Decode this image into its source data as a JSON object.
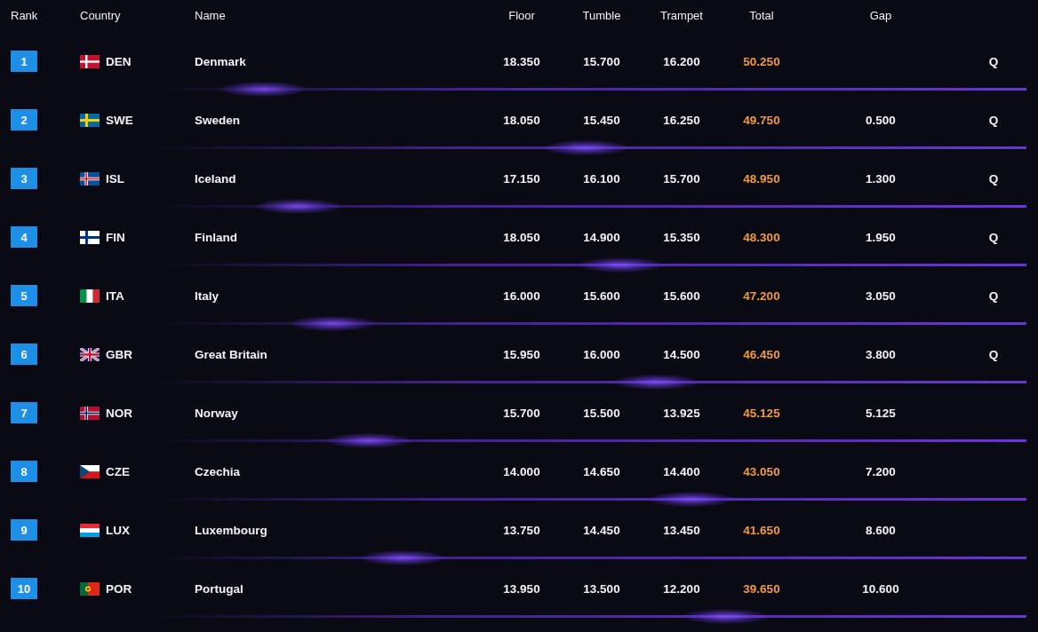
{
  "columns": [
    "Rank",
    "Country",
    "Name",
    "Floor",
    "Tumble",
    "Trampet",
    "Total",
    "Gap"
  ],
  "rows": [
    {
      "rank": "1",
      "kind": "dk",
      "code": "DEN",
      "name": "Denmark",
      "floor": "18.350",
      "tumble": "15.700",
      "trampet": "16.200",
      "total": "50.250",
      "status": "Q"
    },
    {
      "rank": "2",
      "kind": "se",
      "code": "SWE",
      "name": "Sweden",
      "floor": "18.050",
      "tumble": "15.450",
      "trampet": "16.250",
      "total": "49.750",
      "gap": "0.500",
      "status": "Q"
    },
    {
      "rank": "3",
      "kind": "is",
      "code": "ISL",
      "name": "Iceland",
      "floor": "17.150",
      "tumble": "16.100",
      "trampet": "15.700",
      "total": "48.950",
      "gap": "1.300",
      "status": "Q"
    },
    {
      "rank": "4",
      "kind": "fi",
      "code": "FIN",
      "name": "Finland",
      "floor": "18.050",
      "tumble": "14.900",
      "trampet": "15.350",
      "total": "48.300",
      "gap": "1.950",
      "status": "Q"
    },
    {
      "rank": "5",
      "kind": "it",
      "code": "ITA",
      "name": "Italy",
      "floor": "16.000",
      "tumble": "15.600",
      "trampet": "15.600",
      "total": "47.200",
      "gap": "3.050",
      "status": "Q"
    },
    {
      "rank": "6",
      "kind": "gb",
      "code": "GBR",
      "name": "Great Britain",
      "floor": "15.950",
      "tumble": "16.000",
      "trampet": "14.500",
      "total": "46.450",
      "gap": "3.800",
      "status": "Q"
    },
    {
      "rank": "7",
      "kind": "no",
      "code": "NOR",
      "name": "Norway",
      "floor": "15.700",
      "tumble": "15.500",
      "trampet": "13.925",
      "total": "45.125",
      "gap": "5.125"
    },
    {
      "rank": "8",
      "kind": "cz",
      "code": "CZE",
      "name": "Czechia",
      "floor": "14.000",
      "tumble": "14.650",
      "trampet": "14.400",
      "total": "43.050",
      "gap": "7.200"
    },
    {
      "rank": "9",
      "kind": "lu",
      "code": "LUX",
      "name": "Luxembourg",
      "floor": "13.750",
      "tumble": "14.450",
      "trampet": "13.450",
      "total": "41.650",
      "gap": "8.600"
    },
    {
      "rank": "10",
      "kind": "pt",
      "code": "POR",
      "name": "Portugal",
      "floor": "13.950",
      "tumble": "13.500",
      "trampet": "12.200",
      "total": "39.650",
      "gap": "10.600"
    }
  ]
}
